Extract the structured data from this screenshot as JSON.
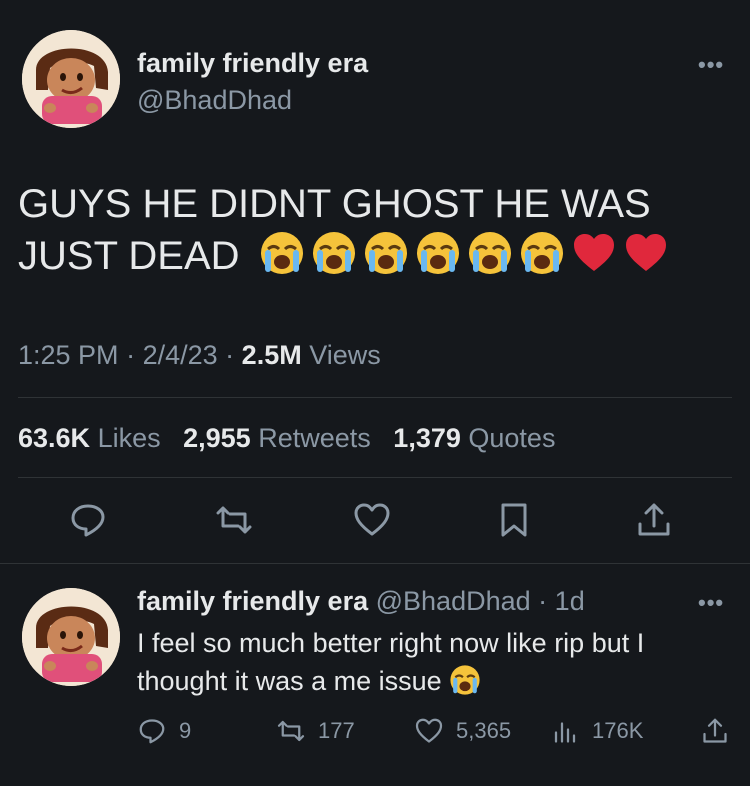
{
  "main_tweet": {
    "display_name": "family friendly era",
    "handle": "@BhadDhad",
    "more": "•••",
    "text": "GUYS HE DIDNT GHOST HE WAS JUST DEAD",
    "emojis": [
      "loudly-crying-face",
      "loudly-crying-face",
      "loudly-crying-face",
      "loudly-crying-face",
      "loudly-crying-face",
      "loudly-crying-face",
      "red-heart",
      "red-heart"
    ],
    "time": "1:25 PM",
    "date": "2/4/23",
    "views_count": "2.5M",
    "views_label": "Views",
    "likes_count": "63.6K",
    "likes_label": "Likes",
    "retweets_count": "2,955",
    "retweets_label": "Retweets",
    "quotes_count": "1,379",
    "quotes_label": "Quotes"
  },
  "reply": {
    "display_name": "family friendly era",
    "handle": "@BhadDhad",
    "time": "1d",
    "more": "•••",
    "text": "I feel so much better right now like rip but I thought it was a me issue",
    "emoji": "loudly-crying-face",
    "reply_count": "9",
    "retweet_count": "177",
    "like_count": "5,365",
    "views_count": "176K"
  },
  "colors": {
    "background": "#15181c",
    "primary_text": "#e7e9ea",
    "secondary_text": "#8b98a5",
    "divider": "#2f3336"
  }
}
